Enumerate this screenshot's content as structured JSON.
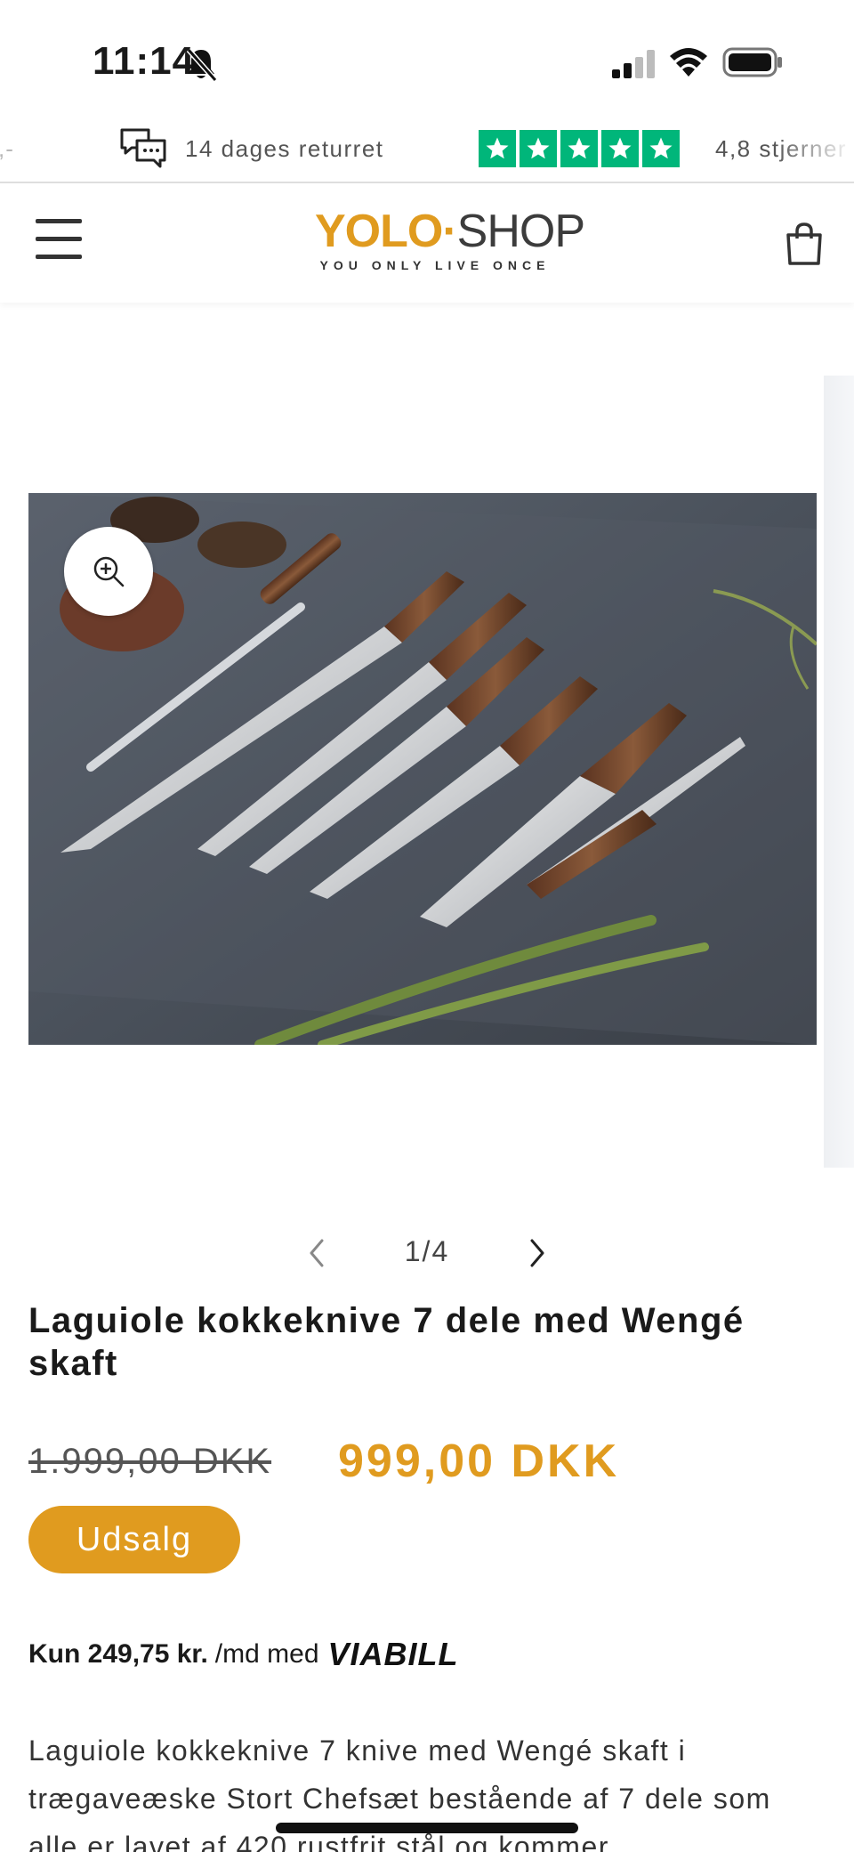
{
  "status_bar": {
    "time": "11:14"
  },
  "announcement": {
    "cut_text": ",-",
    "returns_text": "14 dages returret",
    "rating_text": "4,8 stjerner",
    "trustpilot_color": "#00b67a"
  },
  "header": {
    "logo_yolo": "YOLO",
    "logo_dot": "·",
    "logo_shop": "SHOP",
    "logo_tagline": "YOU ONLY LIVE ONCE",
    "accent_color": "#e09b1f"
  },
  "gallery": {
    "pager_text": "1/4"
  },
  "product": {
    "title": "Laguiole kokkeknive 7 dele med Wengé skaft",
    "price_old": "1.999,00 DKK",
    "price_new": "999,00 DKK",
    "sale_label": "Udsalg",
    "viabill_amount": "Kun 249,75 kr.",
    "viabill_per": "/md med",
    "viabill_brand": "VIABILL",
    "description": "Laguiole kokkeknive 7 knive med Wengé skaft i trægaveæske Stort Chefsæt bestående af 7 dele som alle er lavet af 420 rustfrit stål og kommer"
  },
  "icons": {
    "bell": "bell-slash-icon",
    "signal": "signal-icon",
    "wifi": "wifi-icon",
    "battery": "battery-icon",
    "chat": "chat-bubbles-icon",
    "menu": "hamburger-menu-icon",
    "cart": "shopping-bag-icon",
    "zoom": "zoom-in-icon",
    "prev": "chevron-left-icon",
    "next": "chevron-right-icon"
  }
}
